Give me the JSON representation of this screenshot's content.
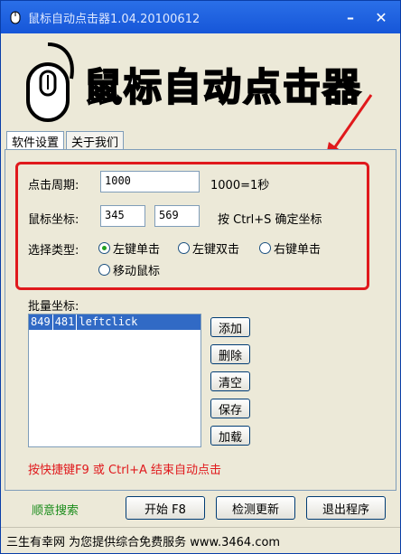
{
  "window": {
    "title": "鼠标自动点击器1.04.20100612",
    "minimize_glyph": "–",
    "close_glyph": "✕"
  },
  "header": {
    "logo_text": "鼠标自动点击器"
  },
  "tabs": [
    {
      "label": "软件设置",
      "active": true
    },
    {
      "label": "关于我们",
      "active": false
    }
  ],
  "settings": {
    "interval_label": "点击周期:",
    "interval_value": "1000",
    "interval_note": "1000=1秒",
    "coord_label": "鼠标坐标:",
    "coord_x": "345",
    "coord_y": "569",
    "coord_hint": "按 Ctrl+S  确定坐标",
    "type_label": "选择类型:",
    "types": [
      {
        "label": "左键单击",
        "selected": true
      },
      {
        "label": "左键双击",
        "selected": false
      },
      {
        "label": "右键单击",
        "selected": false
      },
      {
        "label": "移动鼠标",
        "selected": false
      }
    ]
  },
  "batch": {
    "label": "批量坐标:",
    "rows": [
      {
        "x": "849",
        "y": "481",
        "action": "leftclick"
      }
    ],
    "buttons": {
      "add": "添加",
      "delete": "删除",
      "clear": "清空",
      "save": "保存",
      "load": "加载"
    }
  },
  "hotkey_notice": "按快捷键F9 或 Ctrl+A 结束自动点击",
  "footer": {
    "link": "顺意搜索",
    "start": "开始 F8",
    "check_update": "检测更新",
    "exit": "退出程序"
  },
  "status_text": "三生有幸网 为您提供综合免费服务 www.3464.com",
  "colors": {
    "title_bar": "#1656d8",
    "highlight": "#e0191c",
    "selection": "#316ac5",
    "link": "#1a8c1a"
  }
}
